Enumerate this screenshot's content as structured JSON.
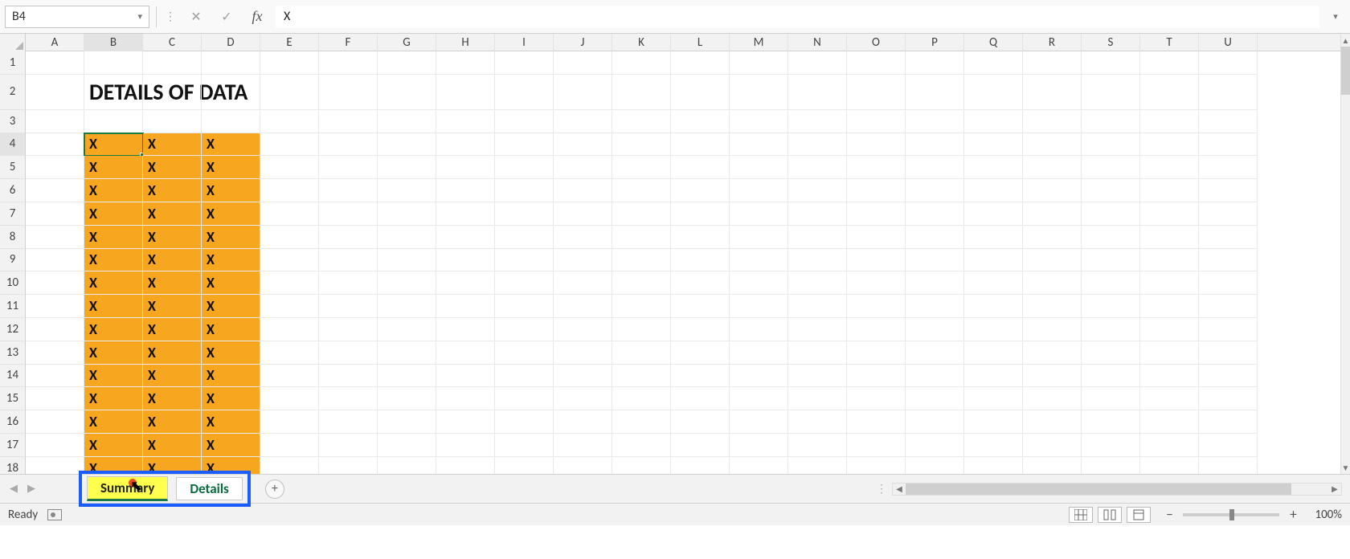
{
  "nameBox": "B4",
  "formulaValue": "X",
  "title": "DETAILS OF DATA",
  "columns": [
    "A",
    "B",
    "C",
    "D",
    "E",
    "F",
    "G",
    "H",
    "I",
    "J",
    "K",
    "L",
    "M",
    "N",
    "O",
    "P",
    "Q",
    "R",
    "S",
    "T",
    "U"
  ],
  "rows": [
    "1",
    "2",
    "3",
    "4",
    "5",
    "6",
    "7",
    "8",
    "9",
    "10",
    "11",
    "12",
    "13",
    "14",
    "15",
    "16",
    "17",
    "18"
  ],
  "activeColumn": "B",
  "activeRow": "4",
  "dataValue": "X",
  "dataRows": 15,
  "sheets": {
    "active": "Summary",
    "other": "Details"
  },
  "status": "Ready",
  "zoom": "100%",
  "icons": {
    "dropdown": "▾",
    "cancel": "✕",
    "enter": "✓",
    "fx": "fx",
    "expand": "▾",
    "scrollUp": "▲",
    "scrollDown": "▼",
    "scrollLeft": "◀",
    "scrollRight": "▶",
    "tabPrev": "◀",
    "tabNext": "▶",
    "addSheet": "+",
    "splitter": "⋮",
    "zoomOut": "−",
    "zoomIn": "+",
    "cursor": "↖"
  }
}
